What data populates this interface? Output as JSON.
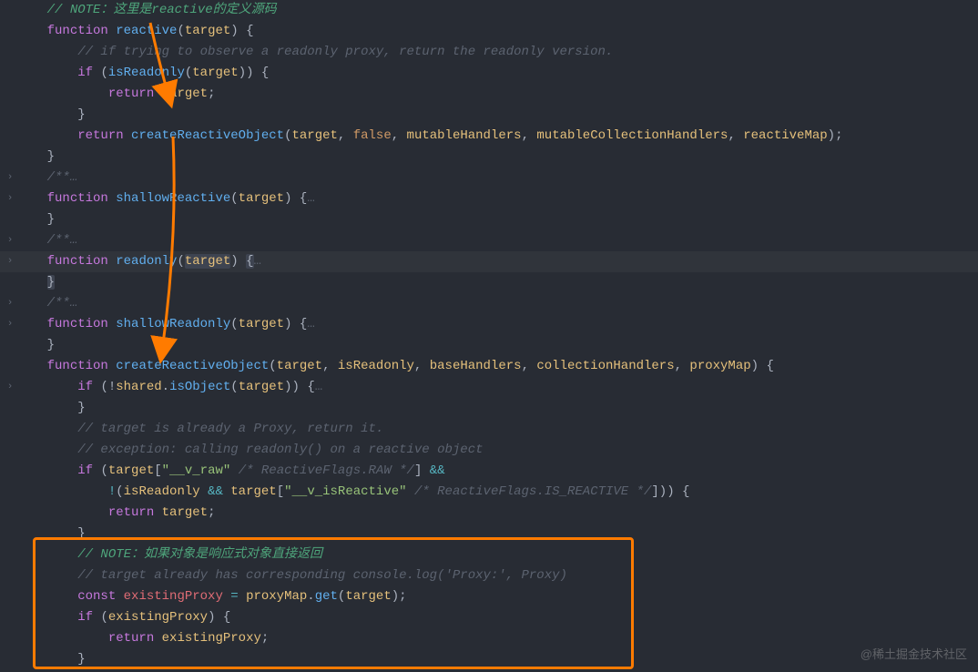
{
  "code": {
    "note1": "// NOTE：这里是reactive的定义源码",
    "l2_kw": "function",
    "l2_fn": "reactive",
    "l2_param": "target",
    "l3_comment": "// if trying to observe a readonly proxy, return the readonly version.",
    "l4_if": "if",
    "l4_fn": "isReadonly",
    "l4_param": "target",
    "l5_return": "return",
    "l5_target": "target",
    "l7_return": "return",
    "l7_fn": "createReactiveObject",
    "l7_args_target": "target",
    "l7_args_false": "false",
    "l7_args_mh": "mutableHandlers",
    "l7_args_mch": "mutableCollectionHandlers",
    "l7_args_rm": "reactiveMap",
    "block_comment": "/**",
    "dots": "…",
    "l10_kw": "function",
    "l10_fn": "shallowReactive",
    "l10_param": "target",
    "l13_kw": "function",
    "l13_fn": "readonly",
    "l13_param": "target",
    "l16_kw": "function",
    "l16_fn": "shallowReadonly",
    "l16_param": "target",
    "l18_kw": "function",
    "l18_fn": "createReactiveObject",
    "l18_p1": "target",
    "l18_p2": "isReadonly",
    "l18_p3": "baseHandlers",
    "l18_p4": "collectionHandlers",
    "l18_p5": "proxyMap",
    "l19_if": "if",
    "l19_shared": "shared",
    "l19_isObject": "isObject",
    "l19_target": "target",
    "l21_comment": "// target is already a Proxy, return it.",
    "l22_comment": "// exception: calling readonly() on a reactive object",
    "l23_if": "if",
    "l23_target": "target",
    "l23_str": "\"__v_raw\"",
    "l23_comment": "/* ReactiveFlags.RAW */",
    "l24_isReadonly": "isReadonly",
    "l24_target": "target",
    "l24_str": "\"__v_isReactive\"",
    "l24_comment": "/* ReactiveFlags.IS_REACTIVE */",
    "l25_return": "return",
    "l25_target": "target",
    "note2": "// NOTE：如果对象是响应式对象直接返回",
    "l28_comment": "// target already has corresponding console.log('Proxy:', Proxy)",
    "l29_const": "const",
    "l29_var": "existingProxy",
    "l29_obj": "proxyMap",
    "l29_get": "get",
    "l29_target": "target",
    "l30_if": "if",
    "l30_var": "existingProxy",
    "l31_return": "return",
    "l31_var": "existingProxy",
    "amp": "&&",
    "bang": "!",
    "fold_chevron": "›"
  },
  "watermark": "@稀土掘金技术社区",
  "colors": {
    "arrow": "#ff7b00",
    "box": "#ff7b00"
  }
}
